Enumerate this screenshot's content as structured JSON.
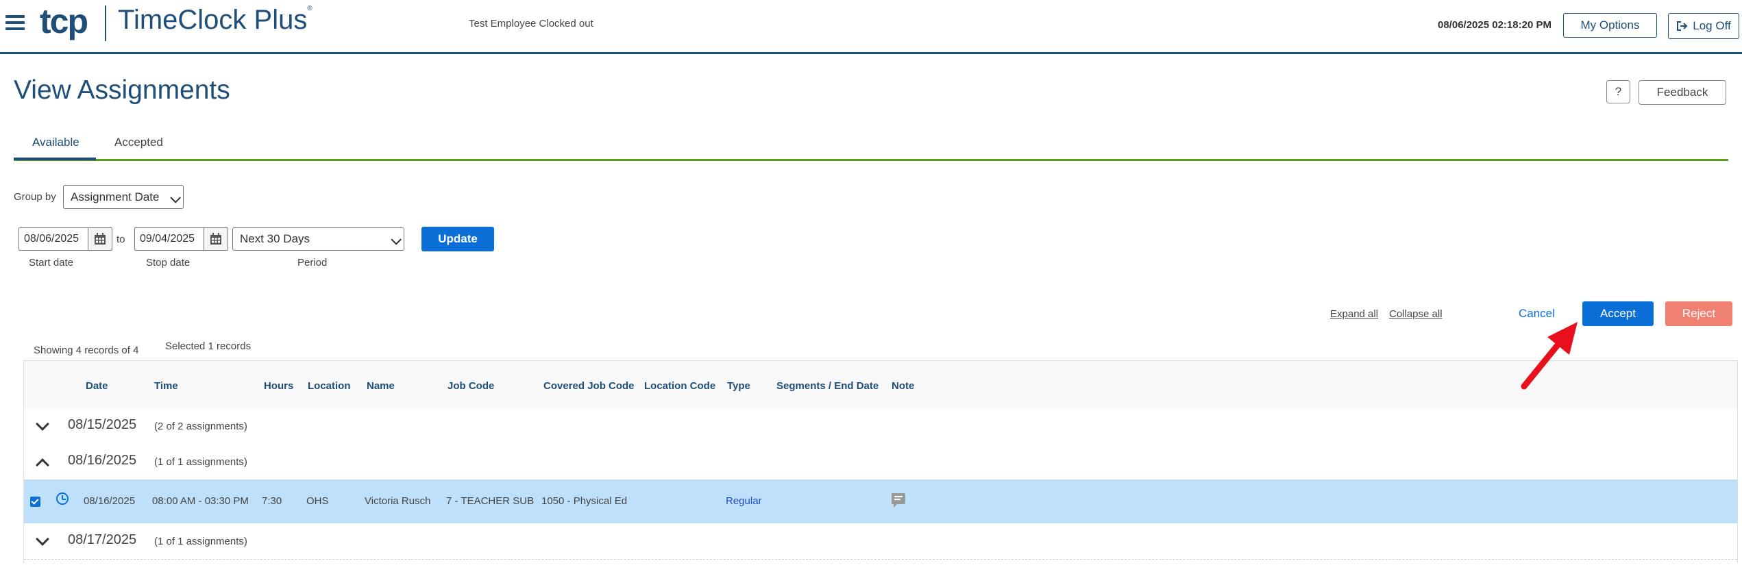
{
  "header": {
    "logo_mark": "tcp",
    "logo_text": "TimeClock Plus",
    "logo_registered": "®",
    "status": "Test Employee Clocked out",
    "datetime": "08/06/2025  02:18:20 PM",
    "my_options": "My Options",
    "log_off": "Log Off"
  },
  "page": {
    "title": "View Assignments",
    "help_label": "?",
    "feedback_label": "Feedback"
  },
  "tabs": [
    {
      "label": "Available",
      "active": true
    },
    {
      "label": "Accepted",
      "active": false
    }
  ],
  "filters": {
    "group_by_label": "Group by",
    "group_by_value": "Assignment Date",
    "start_date": "08/06/2025",
    "to_label": "to",
    "stop_date": "09/04/2025",
    "period": "Next 30 Days",
    "update_label": "Update",
    "start_date_label": "Start date",
    "stop_date_label": "Stop date",
    "period_label": "Period"
  },
  "actions": {
    "expand_all": "Expand all",
    "collapse_all": "Collapse all",
    "cancel": "Cancel",
    "accept": "Accept",
    "reject": "Reject"
  },
  "summary": {
    "showing": "Showing 4 records of 4",
    "selected": "Selected 1 records"
  },
  "table": {
    "columns": [
      "Date",
      "Time",
      "Hours",
      "Location",
      "Name",
      "Job Code",
      "Covered Job Code",
      "Location Code",
      "Type",
      "Segments / End Date",
      "Note"
    ],
    "groups": [
      {
        "date": "08/15/2025",
        "count": "(2 of 2 assignments)",
        "expanded": false
      },
      {
        "date": "08/16/2025",
        "count": "(1 of 1 assignments)",
        "expanded": true
      },
      {
        "date": "08/17/2025",
        "count": "(1 of 1 assignments)",
        "expanded": false
      }
    ],
    "row": {
      "selected": true,
      "date": "08/16/2025",
      "time": "08:00 AM - 03:30 PM",
      "hours": "7:30",
      "location": "OHS",
      "name": "Victoria Rusch",
      "job_code": "7 - TEACHER SUB",
      "covered_job_code": "1050 - Physical Ed",
      "location_code": "",
      "type": "Regular",
      "segments": ""
    }
  },
  "colors": {
    "brand": "#1f4e79",
    "accent_green": "#5a9e1e",
    "primary_button": "#0b6fd8",
    "reject_button": "#f08070",
    "selected_row": "#bfe0fb",
    "annotation_arrow": "#e8101c"
  }
}
